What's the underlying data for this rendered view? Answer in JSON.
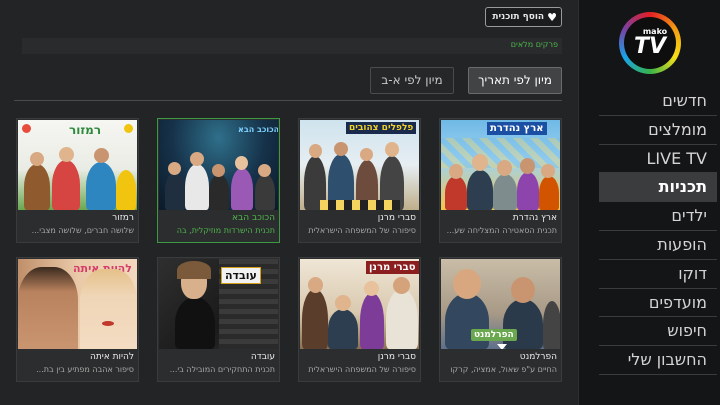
{
  "app": {
    "logo_small": "mako",
    "logo_big": "TV"
  },
  "topbar": {
    "add_show_label": "הוסף תוכנית"
  },
  "breadcrumb": "פרקים מלאים",
  "sort": {
    "by_date": "מיון לפי תאריך",
    "by_alpha": "מיון לפי א-ב"
  },
  "sidebar": {
    "items": [
      {
        "label": "חדשים"
      },
      {
        "label": "מומלצים"
      },
      {
        "label": "LIVE TV"
      },
      {
        "label": "תכניות",
        "active": true
      },
      {
        "label": "ילדים"
      },
      {
        "label": "הופעות"
      },
      {
        "label": "דוקו"
      },
      {
        "label": "מועדפים"
      },
      {
        "label": "חיפוש"
      },
      {
        "label": "החשבון שלי"
      }
    ]
  },
  "shows": [
    {
      "title": "ארץ נהדרת",
      "desc": "תכנית הסאטירה המצליחה  שע...",
      "thumb_label": "ארץ נהדרת"
    },
    {
      "title": "סברי מרנן",
      "desc": "סיפורה של המשפחה הישראלית",
      "thumb_label": "פלפלים צהובים"
    },
    {
      "title": "הכוכב הבא",
      "desc": "תכנית הישרדות מוזיקלית, בה",
      "thumb_label": "הכוכב הבא"
    },
    {
      "title": "רמזור",
      "desc": "שלושה חברים, שלושה מצבי...",
      "thumb_label": "רמזור"
    },
    {
      "title": "הפרלמנט",
      "desc": "החיים ע\"פ שאול, אמציה, קרקו",
      "thumb_label": "הפרלמנט"
    },
    {
      "title": "סברי מרנן",
      "desc": "סיפורה של המשפחה הישראלית",
      "thumb_label": "סברי מרנן"
    },
    {
      "title": "עובדה",
      "desc": "תכנית התחקירים המובילה בי...",
      "thumb_label": "עובדה"
    },
    {
      "title": "להיות איתה",
      "desc": "סיפור אהבה מפתיע בין בת...",
      "thumb_label": "להיות איתה"
    }
  ]
}
